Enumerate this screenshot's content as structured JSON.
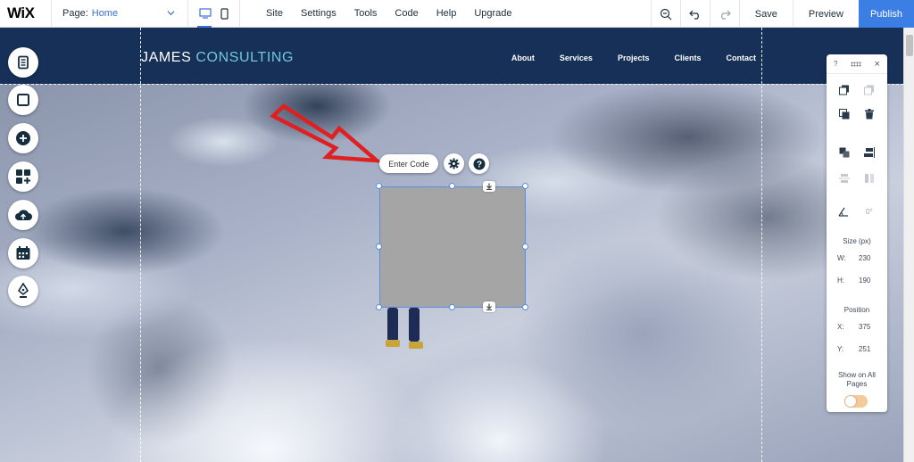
{
  "topbar": {
    "logo": "WiX",
    "page_prefix": "Page:",
    "page_name": "Home",
    "menu": [
      "Site",
      "Settings",
      "Tools",
      "Code",
      "Help",
      "Upgrade"
    ],
    "save": "Save",
    "preview": "Preview",
    "publish": "Publish"
  },
  "site": {
    "brand_part1": "JAMES ",
    "brand_part2": "CONSULTING",
    "nav": [
      "About",
      "Services",
      "Projects",
      "Clients",
      "Contact"
    ]
  },
  "element": {
    "enter_code": "Enter Code"
  },
  "panel": {
    "help": "?",
    "close": "×",
    "rotation": "0°",
    "size_label": "Size (px)",
    "w_label": "W:",
    "w_value": "230",
    "h_label": "H:",
    "h_value": "190",
    "position_label": "Position",
    "x_label": "X:",
    "x_value": "375",
    "y_label": "Y:",
    "y_value": "251",
    "show_all_pages": "Show on All Pages"
  },
  "colors": {
    "header_bg": "#163058",
    "brand_accent": "#6fc8d8",
    "publish_bg": "#3b7fe5",
    "selection": "#5b8de0",
    "arrow": "#e02020"
  }
}
